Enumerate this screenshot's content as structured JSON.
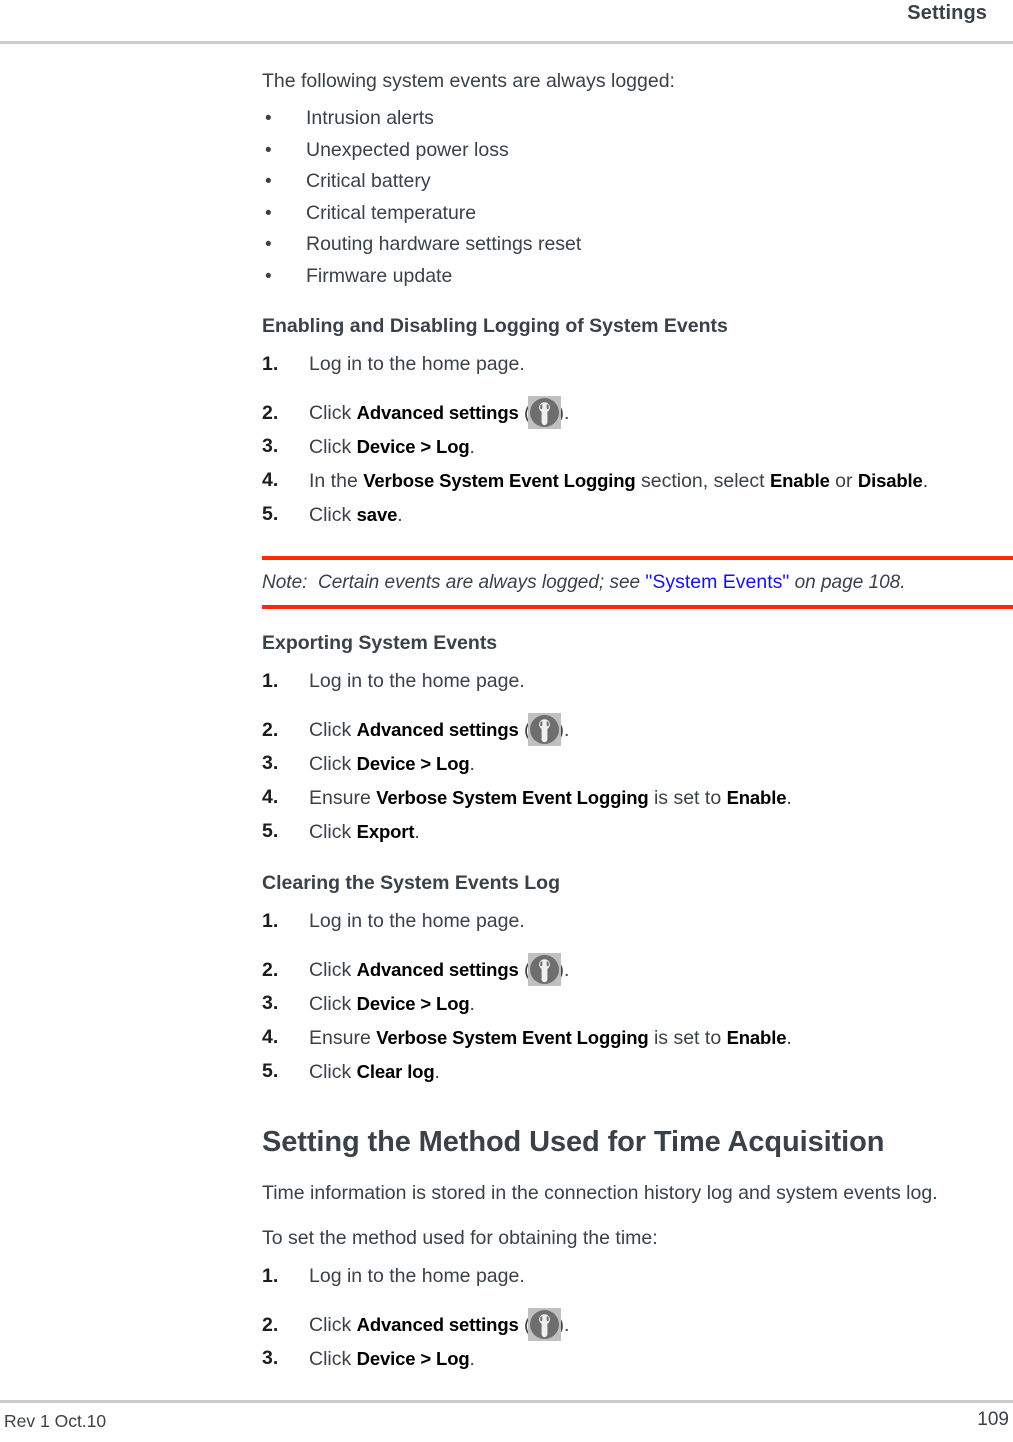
{
  "header": {
    "title": "Settings"
  },
  "intro": {
    "lead": "The following system events are always logged:",
    "bullet_glyph": "•",
    "bullets": [
      "Intrusion alerts",
      "Unexpected power loss",
      "Critical battery",
      "Critical temperature",
      "Routing hardware settings reset",
      "Firmware update"
    ]
  },
  "icons": {
    "wrench": "wrench-icon"
  },
  "sections": [
    {
      "heading": "Enabling and Disabling Logging of System Events",
      "steps": [
        {
          "num": "1.",
          "pre": "Log in to the home page.",
          "bold": "",
          "post": "",
          "icon": false
        },
        {
          "num": "2.",
          "pre": "Click ",
          "bold": "Advanced settings",
          "post": ").",
          "mid": " (",
          "icon": true
        },
        {
          "num": "3.",
          "pre": "Click ",
          "bold": "Device > Log",
          "post": ".",
          "icon": false
        },
        {
          "num": "4.",
          "pre": "In the ",
          "bold": "Verbose System Event Logging",
          "post": " section, select ",
          "bold2": "Enable",
          "post2": " or ",
          "bold3": "Disable",
          "post3": ".",
          "icon": false
        },
        {
          "num": "5.",
          "pre": "Click ",
          "bold": "save",
          "post": ".",
          "icon": false
        }
      ]
    },
    {
      "heading": "Exporting System Events",
      "steps": [
        {
          "num": "1.",
          "pre": "Log in to the home page.",
          "bold": "",
          "post": "",
          "icon": false
        },
        {
          "num": "2.",
          "pre": "Click ",
          "bold": "Advanced settings",
          "mid": " (",
          "post": ").",
          "icon": true
        },
        {
          "num": "3.",
          "pre": "Click ",
          "bold": "Device > Log",
          "post": ".",
          "icon": false
        },
        {
          "num": "4.",
          "pre": "Ensure ",
          "bold": "Verbose System Event Logging",
          "post": " is set to ",
          "bold2": "Enable",
          "post2": ".",
          "icon": false
        },
        {
          "num": "5.",
          "pre": "Click ",
          "bold": "Export",
          "post": ".",
          "icon": false
        }
      ]
    },
    {
      "heading": "Clearing the System Events Log",
      "steps": [
        {
          "num": "1.",
          "pre": "Log in to the home page.",
          "bold": "",
          "post": "",
          "icon": false
        },
        {
          "num": "2.",
          "pre": "Click ",
          "bold": "Advanced settings",
          "mid": " (",
          "post": ").",
          "icon": true
        },
        {
          "num": "3.",
          "pre": "Click ",
          "bold": "Device > Log",
          "post": ".",
          "icon": false
        },
        {
          "num": "4.",
          "pre": "Ensure ",
          "bold": "Verbose System Event Logging",
          "post": " is set to ",
          "bold2": "Enable",
          "post2": ".",
          "icon": false
        },
        {
          "num": "5.",
          "pre": "Click ",
          "bold": "Clear log",
          "post": ".",
          "icon": false
        }
      ]
    }
  ],
  "note": {
    "label": "Note:",
    "text_before": "Certain events are always logged; see ",
    "link_text": "\"System Events\"",
    "text_after": " on page 108.",
    "rule_color": "#f92c05",
    "link_color": "#1414e8"
  },
  "time_section": {
    "heading": "Setting the Method Used for Time Acquisition",
    "para1": "Time information is stored in the connection history log and system events log.",
    "para2": "To set the method used for obtaining the time:",
    "steps": [
      {
        "num": "1.",
        "pre": "Log in to the home page.",
        "bold": "",
        "post": "",
        "icon": false
      },
      {
        "num": "2.",
        "pre": "Click ",
        "bold": "Advanced settings",
        "mid": " (",
        "post": ").",
        "icon": true
      },
      {
        "num": "3.",
        "pre": "Click ",
        "bold": "Device > Log",
        "post": ".",
        "icon": false
      }
    ]
  },
  "footer": {
    "left": "Rev 1  Oct.10",
    "page_number": "109"
  }
}
